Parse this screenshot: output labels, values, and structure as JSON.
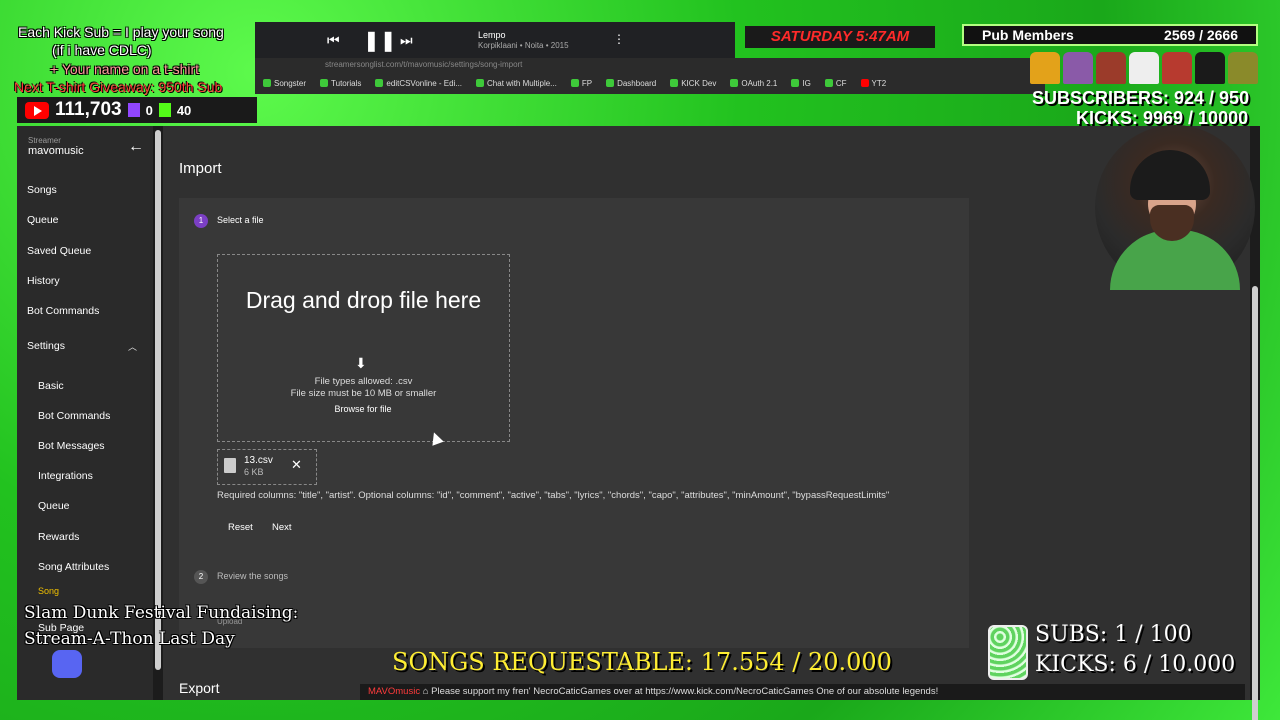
{
  "overlay": {
    "sub_promo_line1": "Each Kick Sub = I play your song",
    "sub_promo_line2": "(if i have CDLC)",
    "sub_promo_line3": "+ Your name on a t-shirt",
    "sub_promo_line4": "Next T-shirt Giveaway: 950th Sub",
    "youtube_subs": "111,703",
    "twitch_count": "0",
    "kick_count": "40",
    "now_playing_title": "Lempo",
    "now_playing_sub": "Korpiklaani • Noita • 2015",
    "day_time": "SATURDAY 5:47AM",
    "pub_members_label": "Pub Members",
    "pub_members_value": "2569 / 2666",
    "subscribers": "SUBSCRIBERS: 924 / 950",
    "kicks": "KICKS: 9969 / 10000",
    "fundraiser_line1": "Slam Dunk Festival Fundaising:",
    "fundraiser_line2": "Stream-A-Thon Last Day",
    "songs_requestable": "SONGS REQUESTABLE: 17.554 / 20.000",
    "ticker": "Please support my fren' NecroCaticGames over at https://www.kick.com/NecroCaticGames One of our absolute legends!",
    "ticker_prefix": "MAVOmusic",
    "subs_goal": "SUBS:  1 / 100",
    "kicks_goal": "KICKS: 6 / 10.000"
  },
  "browser": {
    "url": "streamersonglist.com/t/mavomusic/settings/song-import",
    "bookmarks": [
      "Songster",
      "Tutorials",
      "editCSVonline - Edi...",
      "Chat with Multiple...",
      "FP",
      "Dashboard",
      "KICK Dev",
      "OAuth 2.1",
      "IG",
      "CF",
      "YT2"
    ]
  },
  "sidebar": {
    "streamer_label": "Streamer",
    "streamer_name": "mavomusic",
    "items": [
      "Songs",
      "Queue",
      "Saved Queue",
      "History",
      "Bot Commands",
      "Settings"
    ],
    "settings_items": [
      "Basic",
      "Bot Commands",
      "Bot Messages",
      "Integrations",
      "Queue",
      "Rewards",
      "Song Attributes"
    ],
    "partial_item": "Song",
    "partial_item2": "Sub Page"
  },
  "main": {
    "import_title": "Import",
    "step1_num": "1",
    "step1_label": "Select a file",
    "dropzone_title": "Drag and drop file here",
    "file_types": "File types allowed: .csv",
    "file_size": "File size must be 10 MB or smaller",
    "browse_label": "Browse for file",
    "file_name": "13.csv",
    "file_size_value": "6 KB",
    "required_columns": "Required columns: \"title\", \"artist\". Optional columns: \"id\", \"comment\", \"active\", \"tabs\", \"lyrics\", \"chords\", \"capo\", \"attributes\", \"minAmount\", \"bypassRequestLimits\"",
    "reset_label": "Reset",
    "next_label": "Next",
    "step2_num": "2",
    "step2_label": "Review the songs",
    "step3_label": "Upload",
    "export_title": "Export"
  },
  "colors": {
    "green_screen": "#29d829",
    "app_bg": "#303030",
    "card_bg": "#383838",
    "step_active": "#7b3fc4",
    "step_inactive": "#555555"
  }
}
